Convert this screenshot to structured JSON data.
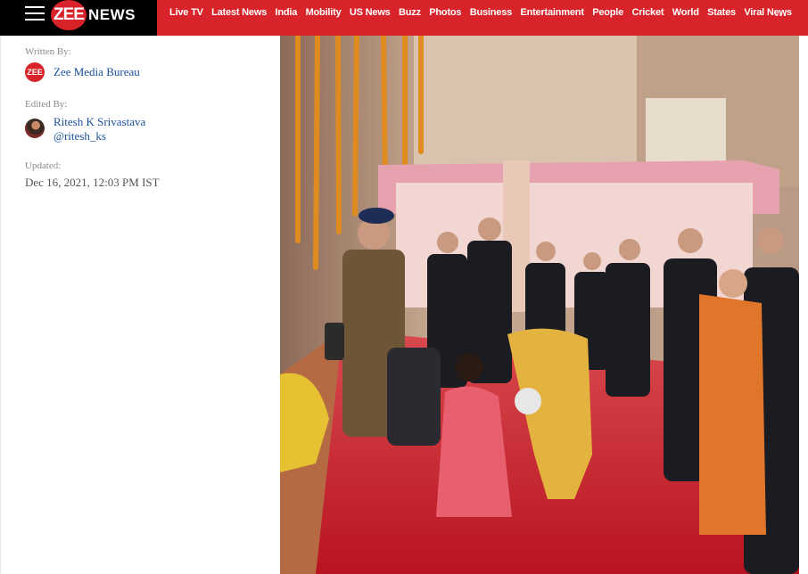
{
  "header": {
    "logo_letters": "ZEE",
    "logo_word": "NEWS",
    "nav_items": [
      "Live TV",
      "Latest News",
      "India",
      "Mobility",
      "US News",
      "Buzz",
      "Photos",
      "Business",
      "Entertainment",
      "People",
      "Cricket",
      "World",
      "States",
      "Viral News"
    ],
    "more_label": "..."
  },
  "article_meta": {
    "written_by_label": "Written By:",
    "author_name": "Zee Media Bureau",
    "author_avatar_text": "ZEE",
    "edited_by_label": "Edited By:",
    "editor_name": "Ritesh K Srivastava",
    "editor_handle": "@ritesh_ks",
    "updated_label": "Updated:",
    "updated_date": "Dec 16, 2021, 12:03 PM IST"
  },
  "colors": {
    "brand_red": "#d8232a",
    "link_blue": "#1a4f9c",
    "carpet_red": "#c8202b"
  }
}
